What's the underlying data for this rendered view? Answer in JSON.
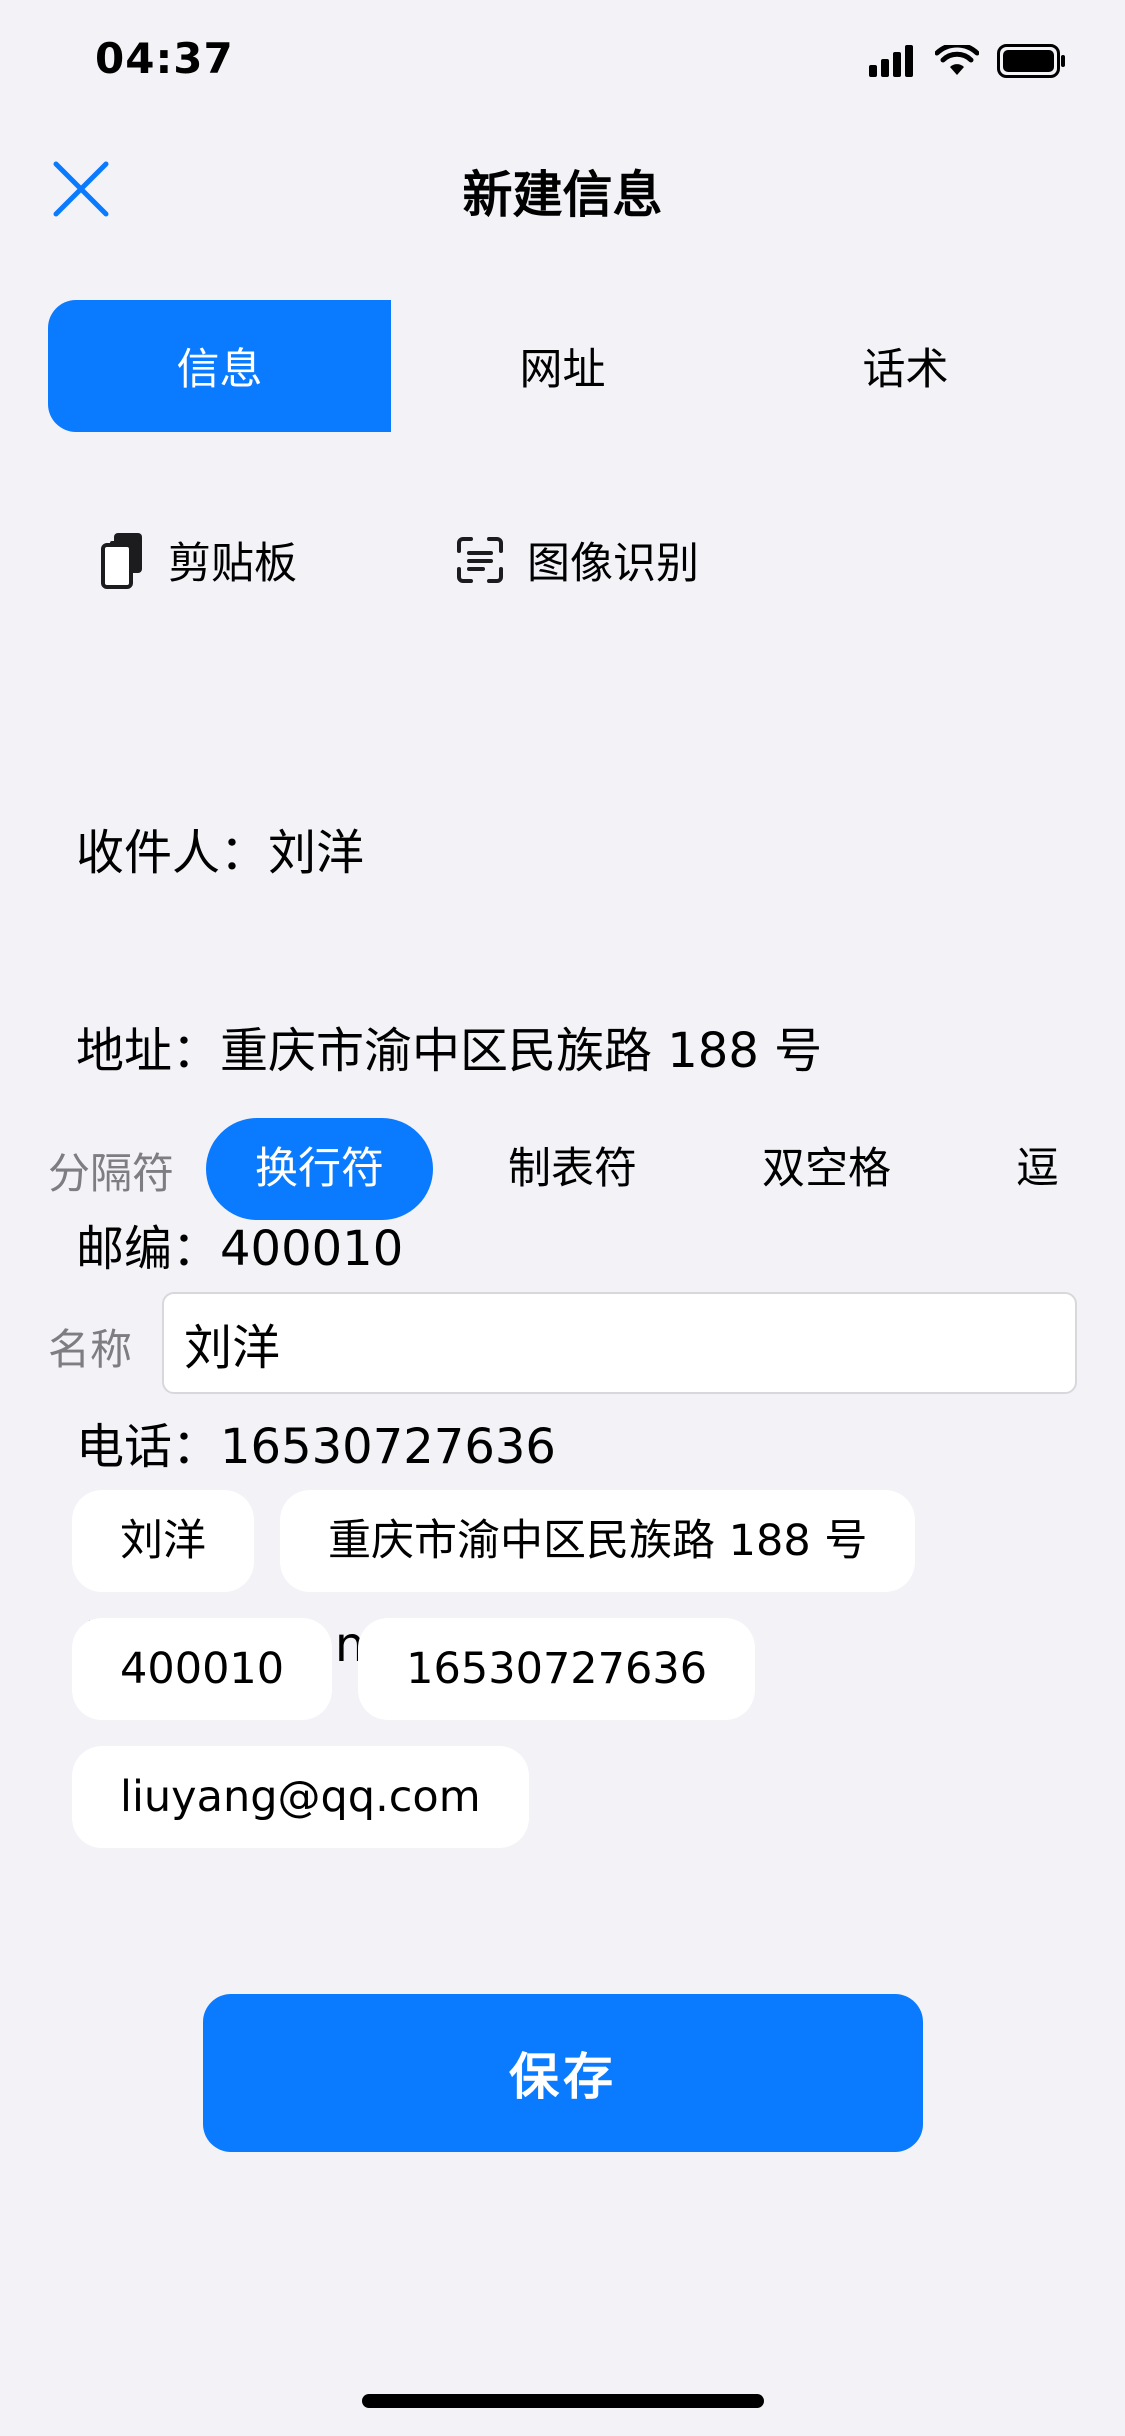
{
  "status_bar": {
    "time": "04:37"
  },
  "nav": {
    "title": "新建信息"
  },
  "tabs": [
    {
      "label": "信息",
      "active": true
    },
    {
      "label": "网址",
      "active": false
    },
    {
      "label": "话术",
      "active": false
    }
  ],
  "tools": {
    "clipboard_label": "剪贴板",
    "ocr_label": "图像识别"
  },
  "text_lines": [
    "收件人：刘洋",
    "地址：重庆市渝中区民族路 188 号",
    "邮编：400010",
    "电话：16530727636",
    "邮箱：liuyang@qq.com"
  ],
  "separator": {
    "label": "分隔符",
    "options": [
      "换行符",
      "制表符",
      "双空格",
      "逗号"
    ],
    "selected": "换行符"
  },
  "name": {
    "label": "名称",
    "value": "刘洋"
  },
  "chips": [
    "刘洋",
    "重庆市渝中区民族路 188 号",
    "400010",
    "16530727636",
    "liuyang@qq.com"
  ],
  "save_label": "保存",
  "colors": {
    "accent": "#0a7aff",
    "background": "#f2f2f7"
  }
}
